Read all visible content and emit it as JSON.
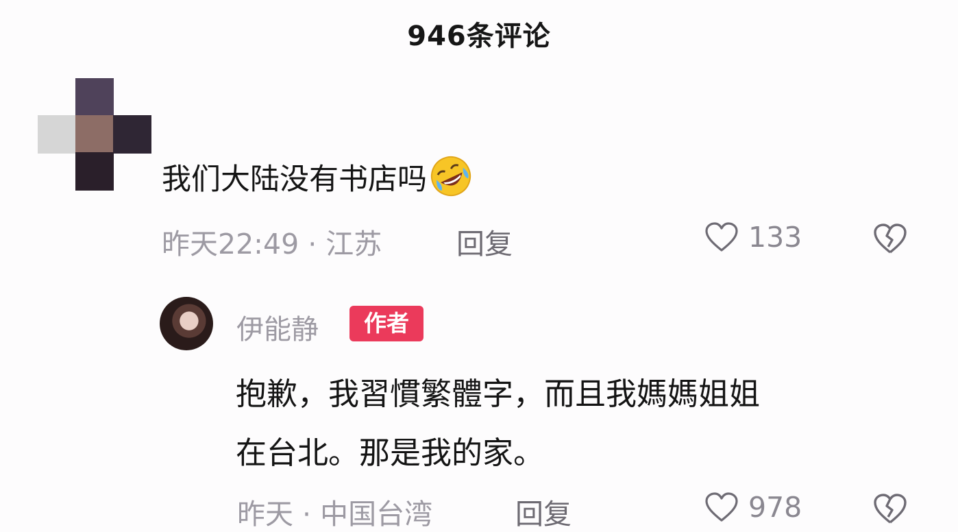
{
  "header": {
    "title": "946条评论"
  },
  "comments": [
    {
      "text": "我们大陆没有书店吗",
      "emoji": "rolling-laughing-face-icon",
      "meta": "昨天22:49 · 江苏",
      "reply_label": "回复",
      "likes": "133"
    }
  ],
  "reply": {
    "author": "伊能静",
    "badge": "作者",
    "text_line1": "抱歉，我習慣繁體字，而且我媽媽姐姐",
    "text_line2": "在台北。那是我的家。",
    "meta": "昨天 · 中国台湾",
    "reply_label": "回复",
    "likes": "978"
  },
  "colors": {
    "badge": "#eb3a5b",
    "meta_text": "#9d9aa3",
    "emoji_yellow": "#f7c526"
  }
}
